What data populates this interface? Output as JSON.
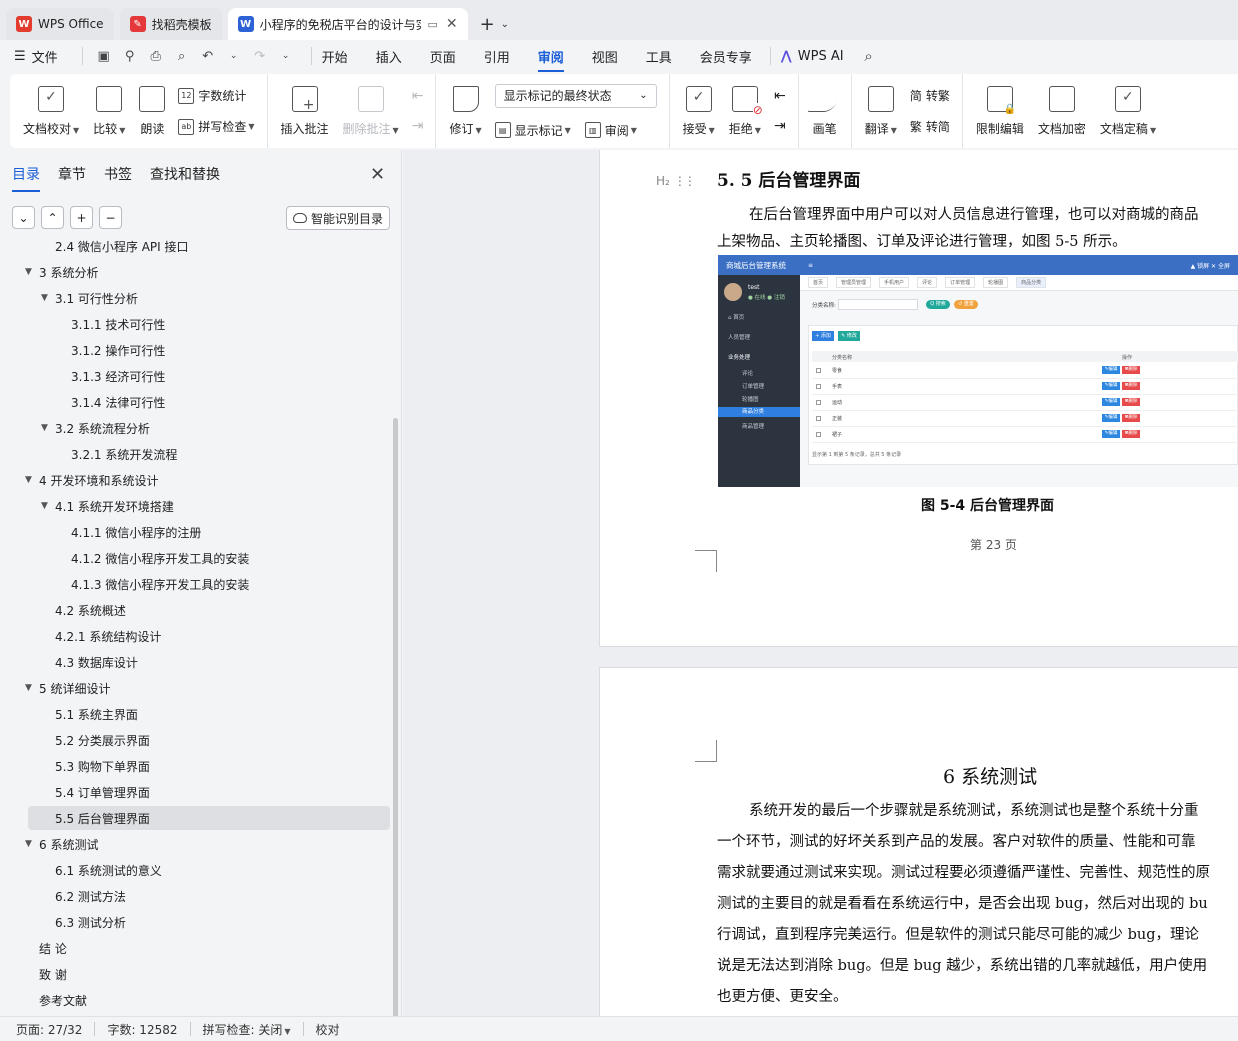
{
  "tabs": [
    {
      "label": "WPS Office",
      "logo": "W",
      "logo_color": "#e33b2e"
    },
    {
      "label": "找稻壳模板",
      "logo": "✎",
      "logo_color": "#e5383b"
    },
    {
      "label": "小程序的免税店平台的设计与实",
      "logo": "W",
      "logo_color": "#2d62d6",
      "active": true
    }
  ],
  "menubar": {
    "file": "文件",
    "tabs": [
      "开始",
      "插入",
      "页面",
      "引用",
      "审阅",
      "视图",
      "工具",
      "会员专享"
    ],
    "active_tab": "审阅",
    "wps_ai": "WPS AI"
  },
  "ribbon": {
    "doc_check": "文档校对",
    "compare": "比较",
    "read_aloud": "朗读",
    "word_count": "字数统计",
    "spell_check": "拼写检查",
    "insert_comment": "插入批注",
    "delete_comment": "删除批注",
    "revise": "修订",
    "markup_state": "显示标记的最终状态",
    "show_markup": "显示标记",
    "review": "审阅",
    "accept": "接受",
    "reject": "拒绝",
    "pen": "画笔",
    "translate": "翻译",
    "to_traditional": "转繁",
    "to_simplified": "转简",
    "restrict_edit": "限制编辑",
    "encrypt": "文档加密",
    "finalize": "文档定稿"
  },
  "sidebar": {
    "tabs": [
      "目录",
      "章节",
      "书签",
      "查找和替换"
    ],
    "smart_toc": "智能识别目录",
    "toc": [
      {
        "label": "2.4 微信小程序 API 接口",
        "indent": 55,
        "arrow": ""
      },
      {
        "label": "3  系统分析",
        "indent": 39,
        "arrow": "▼"
      },
      {
        "label": "3.1  可行性分析",
        "indent": 55,
        "arrow": "▼"
      },
      {
        "label": "3.1.1  技术可行性",
        "indent": 71,
        "arrow": ""
      },
      {
        "label": "3.1.2 操作可行性",
        "indent": 71,
        "arrow": ""
      },
      {
        "label": "3.1.3  经济可行性",
        "indent": 71,
        "arrow": ""
      },
      {
        "label": "3.1.4  法律可行性",
        "indent": 71,
        "arrow": ""
      },
      {
        "label": "3.2 系统流程分析",
        "indent": 55,
        "arrow": "▼"
      },
      {
        "label": "3.2.1 系统开发流程",
        "indent": 71,
        "arrow": ""
      },
      {
        "label": "4  开发环境和系统设计",
        "indent": 39,
        "arrow": "▼"
      },
      {
        "label": "4.1 系统开发环境搭建",
        "indent": 55,
        "arrow": "▼"
      },
      {
        "label": "4.1.1    微信小程序的注册",
        "indent": 71,
        "arrow": ""
      },
      {
        "label": "4.1.2  微信小程序开发工具的安装",
        "indent": 71,
        "arrow": ""
      },
      {
        "label": "4.1.3  微信小程序开发工具的安装",
        "indent": 71,
        "arrow": ""
      },
      {
        "label": "4.2  系统概述",
        "indent": 55,
        "arrow": ""
      },
      {
        "label": "4.2.1  系统结构设计",
        "indent": 55,
        "arrow": ""
      },
      {
        "label": "4.3 数据库设计",
        "indent": 55,
        "arrow": ""
      },
      {
        "label": "5 统详细设计",
        "indent": 39,
        "arrow": "▼"
      },
      {
        "label": "5.1 系统主界面",
        "indent": 55,
        "arrow": ""
      },
      {
        "label": "5.2 分类展示界面",
        "indent": 55,
        "arrow": ""
      },
      {
        "label": "5.3 购物下单界面",
        "indent": 55,
        "arrow": ""
      },
      {
        "label": "5.4 订单管理界面",
        "indent": 55,
        "arrow": ""
      },
      {
        "label": "5.5 后台管理界面",
        "indent": 55,
        "arrow": "",
        "selected": true
      },
      {
        "label": "6 系统测试",
        "indent": 39,
        "arrow": "▼"
      },
      {
        "label": "6.1 系统测试的意义",
        "indent": 55,
        "arrow": ""
      },
      {
        "label": "6.2  测试方法",
        "indent": 55,
        "arrow": ""
      },
      {
        "label": "6.3 测试分析",
        "indent": 55,
        "arrow": ""
      },
      {
        "label": "结      论",
        "indent": 39,
        "arrow": ""
      },
      {
        "label": "致      谢",
        "indent": 39,
        "arrow": ""
      },
      {
        "label": "参考文献",
        "indent": 39,
        "arrow": ""
      }
    ]
  },
  "document": {
    "heading_marker": "H₂",
    "section_heading": "5. 5 后台管理界面",
    "para1_line1": "在后台管理界面中用户可以对人员信息进行管理，也可以对商城的商品",
    "para1_line2": "上架物品、主页轮播图、订单及评论进行管理，如图 5-5 所示。",
    "figure_caption": "图 5-4  后台管理界面",
    "page_number": "第  23  页",
    "chapter_heading": "6 系统测试",
    "para2_lines": [
      "系统开发的最后一个步骤就是系统测试，系统测试也是整个系统十分重",
      "一个环节，测试的好坏关系到产品的发展。客户对软件的质量、性能和可靠",
      "需求就要通过测试来实现。测试过程要必须遵循严谨性、完善性、规范性的原",
      "测试的主要目的就是看看在系统运行中，是否会出现 bug，然后对出现的 bu",
      "行调试，直到程序完美运行。但是软件的测试只能尽可能的减少 bug，理论",
      "说是无法达到消除 bug。但是 bug 越少，系统出错的几率就越低，用户使用",
      "也更方便、更安全。"
    ],
    "screenshot": {
      "title": "商城后台管理系统",
      "top_right": "▲ 锁屏    ✕ 全屏",
      "user_name": "test",
      "user_status": "● 在线  ● 注销",
      "menu": [
        "⌂ 首页",
        "人员管理",
        "业务处理",
        "评论",
        "订单管理",
        "轮播图",
        "商品分类",
        "商品管理"
      ],
      "crumbs": [
        "首页",
        "管理员管理",
        "手机用户",
        "评论",
        "订单管理",
        "轮播图",
        "商品分类"
      ],
      "filter_label": "分类名称:",
      "search_btn": "Q 搜索",
      "reset_btn": "↺ 重置",
      "add_btn": "+ 添加",
      "edit_btn": "✎ 修改",
      "col_name": "分类名称",
      "col_op": "操作",
      "rows": [
        "零食",
        "手表",
        "运动",
        "正装",
        "裙子"
      ],
      "row_edit": "✎编辑",
      "row_delete": "✖删除",
      "footer": "显示第 1 到第 5 条记录，总共 5 条记录"
    }
  },
  "status": {
    "page": "页面: 27/32",
    "words": "字数: 12582",
    "spell": "拼写检查: 关闭",
    "proof": "校对"
  }
}
